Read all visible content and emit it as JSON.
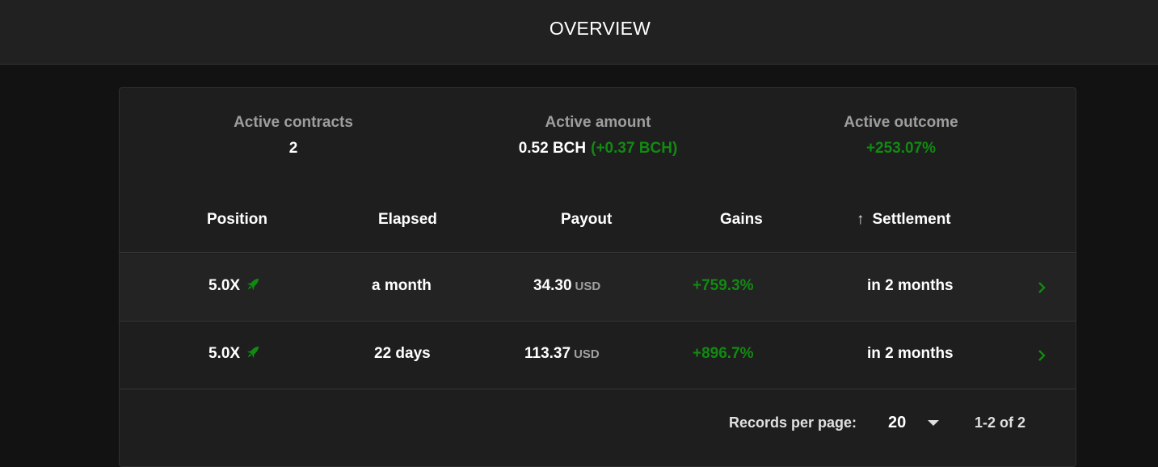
{
  "header": {
    "title": "OVERVIEW"
  },
  "summary": {
    "contracts": {
      "label": "Active contracts",
      "value": "2"
    },
    "amount": {
      "label": "Active amount",
      "value": "0.52 BCH",
      "change": "(+0.37 BCH)"
    },
    "outcome": {
      "label": "Active outcome",
      "value": "+253.07%"
    }
  },
  "table": {
    "columns": [
      "Position",
      "Elapsed",
      "Payout",
      "Gains",
      "Settlement"
    ],
    "sort": {
      "column": "Settlement",
      "direction": "ascending",
      "arrow": "↑"
    },
    "rows": [
      {
        "position": "5.0X",
        "elapsed": "a month",
        "payout": "34.30",
        "currency": "USD",
        "gains": "+759.3%",
        "settlement": "in 2 months"
      },
      {
        "position": "5.0X",
        "elapsed": "22 days",
        "payout": "113.37",
        "currency": "USD",
        "gains": "+896.7%",
        "settlement": "in 2 months"
      }
    ]
  },
  "pagination": {
    "label": "Records per page:",
    "per_page": "20",
    "range": "1-2 of 2"
  },
  "icons": {
    "position_icon": "rocket-icon",
    "row_action_icon": "chevron-right-icon",
    "select_icon": "caret-down-icon",
    "sort_icon": "arrow-up-icon"
  },
  "colors": {
    "background": "#121212",
    "card": "#1e1e1e",
    "positive": "#118a11",
    "muted_label": "#9e9e9e"
  }
}
